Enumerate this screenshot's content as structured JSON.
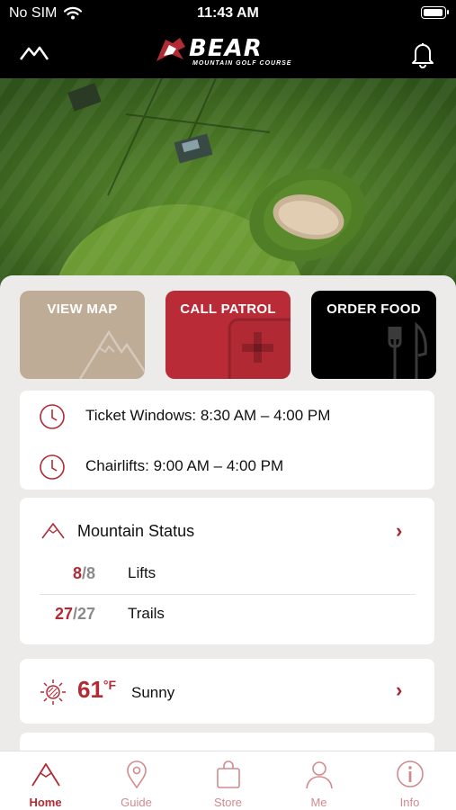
{
  "status_bar": {
    "carrier": "No SIM",
    "time": "11:43 AM"
  },
  "header": {
    "brand": "BEAR",
    "tagline": "MOUNTAIN GOLF COURSE",
    "left_icon": "mountain-icon",
    "right_icon": "bell-icon"
  },
  "actions": [
    {
      "label": "VIEW MAP",
      "icon": "mountain-icon",
      "color": "#bfac96"
    },
    {
      "label": "CALL PATROL",
      "icon": "plus-icon",
      "color": "#b92b36"
    },
    {
      "label": "ORDER FOOD",
      "icon": "fork-knife-icon",
      "color": "#000000"
    }
  ],
  "hours": [
    {
      "text": "Ticket Windows: 8:30 AM – 4:00 PM",
      "icon": "clock-icon"
    },
    {
      "text": "Chairlifts: 9:00 AM – 4:00 PM",
      "icon": "clock-icon"
    }
  ],
  "mountain_status": {
    "title": "Mountain Status",
    "rows": [
      {
        "open": "8",
        "total": "/8",
        "label": "Lifts"
      },
      {
        "open": "27",
        "total": "/27",
        "label": "Trails"
      }
    ]
  },
  "weather": {
    "temp": "61",
    "unit": "°F",
    "condition": "Sunny",
    "icon": "sun-icon"
  },
  "tabs": [
    {
      "label": "Home",
      "icon": "mountain-icon",
      "active": true
    },
    {
      "label": "Guide",
      "icon": "map-pin-icon"
    },
    {
      "label": "Store",
      "icon": "shopping-bag-icon"
    },
    {
      "label": "Me",
      "icon": "user-icon"
    },
    {
      "label": "Info",
      "icon": "info-icon"
    }
  ],
  "colors": {
    "accent": "#b22a34",
    "tab_inactive": "#d28a8f",
    "background": "#ecebea"
  }
}
